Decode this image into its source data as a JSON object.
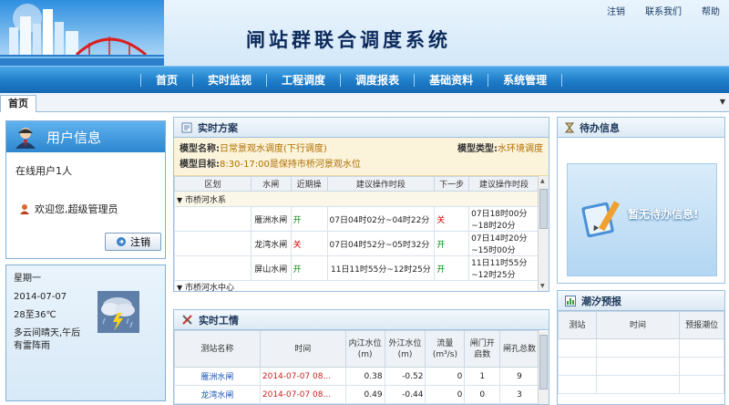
{
  "header": {
    "title": "闸站群联合调度系统",
    "links": [
      "注销",
      "联系我们",
      "帮助"
    ]
  },
  "nav": {
    "items": [
      "首页",
      "实时监视",
      "工程调度",
      "调度报表",
      "基础资料",
      "系统管理"
    ]
  },
  "tabs": {
    "active": "首页"
  },
  "user_panel": {
    "title": "用户信息",
    "online": "在线用户1人",
    "welcome": "欢迎您,超级管理员",
    "logout": "注销"
  },
  "weather": {
    "weekday": "星期一",
    "date": "2014-07-07",
    "temp": "28至36℃",
    "desc": "多云间晴天,午后有雷阵雨"
  },
  "plan": {
    "title": "实时方案",
    "model_name_label": "模型名称:",
    "model_name": "日常景观水调度(下行调度)",
    "model_type_label": "模型类型:",
    "model_type": "水环境调度",
    "model_goal_label": "模型目标:",
    "model_goal": "8:30-17:00是保持市桥河景观水位",
    "headers": [
      "区划",
      "水闸",
      "近期操",
      "建议操作时段",
      "下一步",
      "建议操作时段"
    ],
    "group": "市桥河水系",
    "rows": [
      {
        "gate": "雁洲水闸",
        "op": "开",
        "period": "07日04时02分~04时22分",
        "next": "关",
        "next_period": "07日18时00分~18时20分"
      },
      {
        "gate": "龙湾水闸",
        "op": "关",
        "period": "07日04时52分~05时32分",
        "next": "开",
        "next_period": "07日14时20分~15时00分"
      },
      {
        "gate": "屏山水闸",
        "op": "开",
        "period": "11日11时55分~12时25分",
        "next": "开",
        "next_period": "11日11时55分~12时25分"
      }
    ],
    "partial_row": "市桥河水中心"
  },
  "realtime": {
    "title": "实时工情",
    "headers": [
      "测站名称",
      "时间",
      "内江水位(m)",
      "外江水位(m)",
      "流量(m³/s)",
      "闸门开启数",
      "闸孔总数"
    ],
    "rows": [
      {
        "name": "雁洲水闸",
        "time": "2014-07-07 08...",
        "inner": "0.38",
        "outer": "-0.52",
        "flow": "0",
        "open": "1",
        "total": "9"
      },
      {
        "name": "龙湾水闸",
        "time": "2014-07-07 08...",
        "inner": "0.49",
        "outer": "-0.44",
        "flow": "0",
        "open": "0",
        "total": "3"
      }
    ]
  },
  "todo": {
    "title": "待办信息",
    "empty": "暂无待办信息!"
  },
  "tide": {
    "title": "潮汐预报",
    "headers": [
      "测站",
      "时间",
      "预报潮位"
    ]
  },
  "colors": {
    "nav_bg": "#1e7cc8",
    "accent_red": "#d20000",
    "accent_green": "#0a8a0a"
  }
}
